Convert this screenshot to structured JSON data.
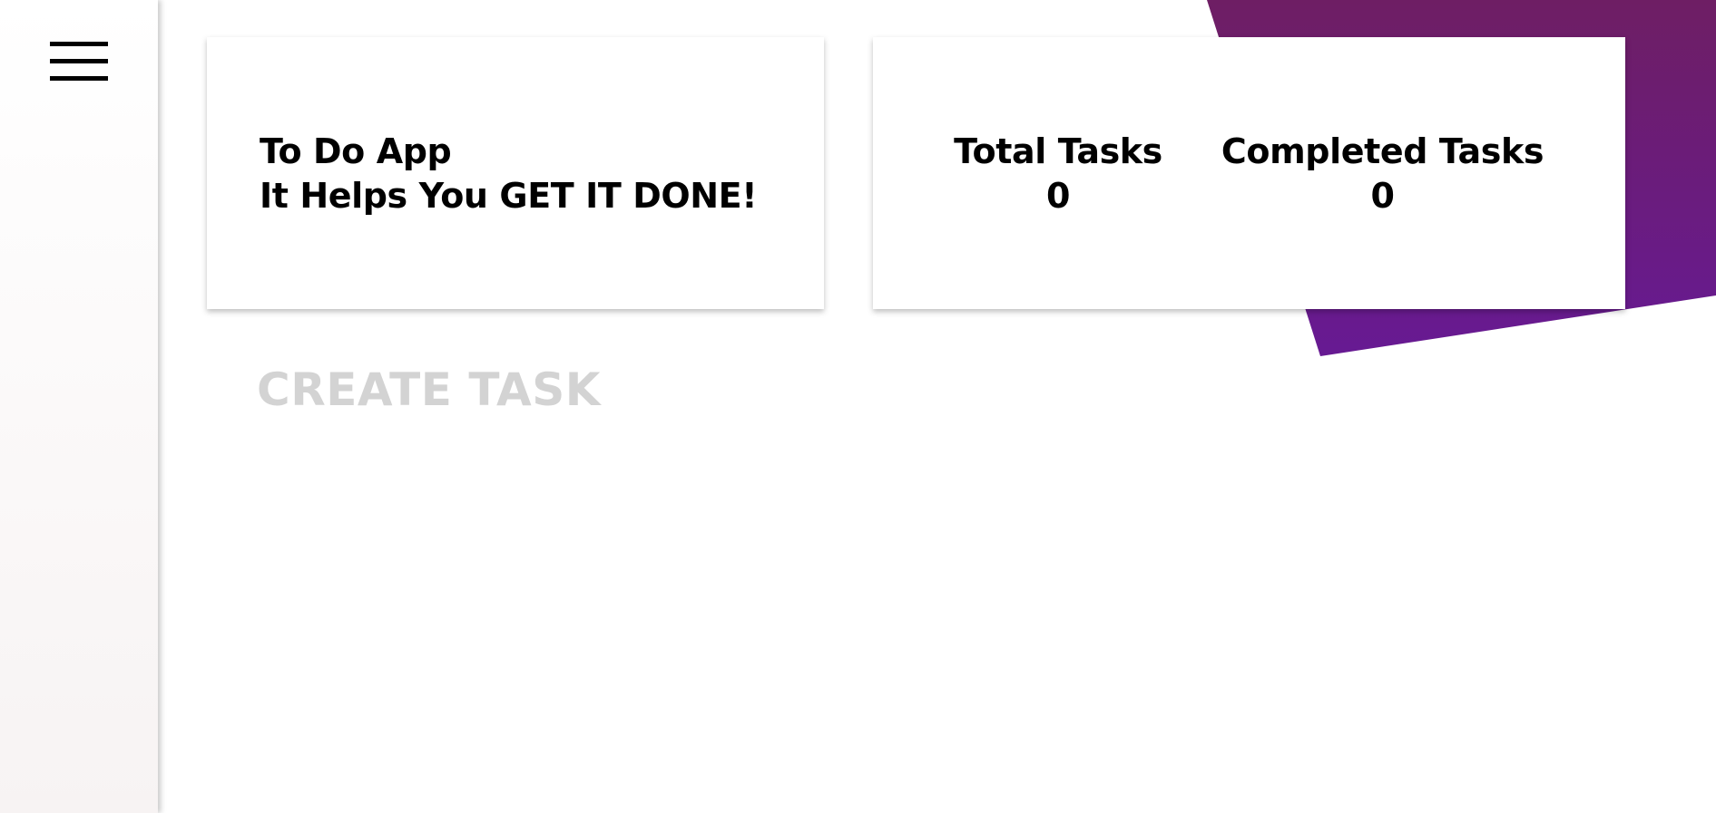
{
  "sidebar": {
    "menu_icon": "hamburger-menu-icon"
  },
  "intro": {
    "title": "To Do App",
    "tagline": "It Helps You GET IT DONE!"
  },
  "stats": {
    "total_label": "Total Tasks",
    "total_value": "0",
    "completed_label": "Completed Tasks",
    "completed_value": "0"
  },
  "create": {
    "heading": "CREATE TASK"
  },
  "colors": {
    "accent_top": "#6e1e64",
    "accent_bottom": "#671a93",
    "heading_muted": "#d3d3d3",
    "text": "#000000"
  }
}
